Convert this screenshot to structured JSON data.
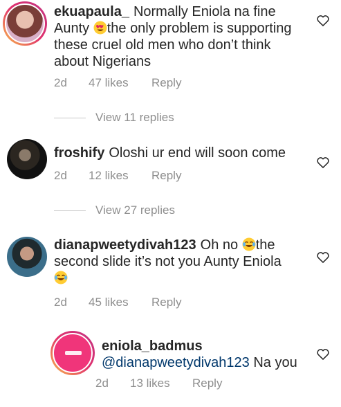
{
  "comments": [
    {
      "username": "ekuapaula_",
      "text_lines": [
        "Normally Eniola na fine",
        "Aunty ",
        "the only problem is supporting",
        "these cruel old men who don’t think",
        "about Nigerians"
      ],
      "time": "2d",
      "likes": "47 likes",
      "reply": "Reply",
      "view_replies": "View 11 replies"
    },
    {
      "username": "froshify",
      "text": "Oloshi ur end will soon come",
      "time": "2d",
      "likes": "12 likes",
      "reply": "Reply",
      "view_replies": "View 27 replies"
    },
    {
      "username": "dianapweetydivah123",
      "text_a": "Oh no ",
      "text_b": "the",
      "text_line2": "second slide it’s not you Aunty Eniola",
      "time": "2d",
      "likes": "45 likes",
      "reply": "Reply"
    }
  ],
  "reply": {
    "username": "eniola_badmus",
    "mention": "@dianapweetydivah123",
    "text": " Na you",
    "time": "2d",
    "likes": "13 likes",
    "reply": "Reply"
  },
  "icons": {
    "heart": "heart-outline-icon",
    "heart_eyes_emoji": "heart-eyes-emoji",
    "laughing_emoji": "tears-of-joy-emoji"
  },
  "colors": {
    "text": "#262626",
    "secondary": "#8e8e8e",
    "mention": "#00376b"
  }
}
